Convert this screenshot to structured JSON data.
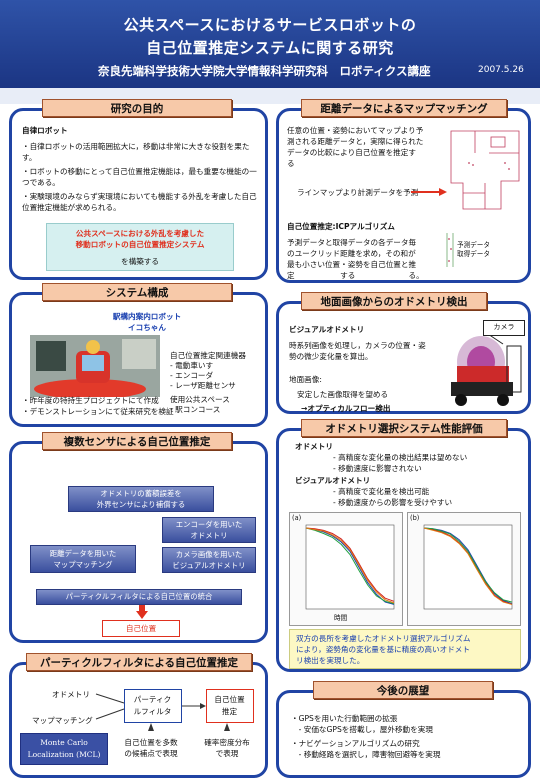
{
  "header": {
    "title_line1": "公共スペースにおけるサービスロボットの",
    "title_line2": "自己位置推定システムに関する研究",
    "affiliation": "奈良先端科学技術大学院大学情報科学研究科　ロボティクス講座",
    "date": "2007.5.26"
  },
  "purpose": {
    "title": "研究の目的",
    "heading": "自律ロボット",
    "bullets": [
      "・自律ロボットの活用範囲拡大に，移動は非常に大きな役割を果たす。",
      "・ロボットの移動にとって自己位置推定機能は，最も重要な機能の一つである。",
      "・実験環境のみならず実環境においても機能する外乱を考慮した自己位置推定機能が求められる。"
    ],
    "highlight_line1": "公共スペースにおける外乱を考慮した",
    "highlight_line2": "移動ロボットの自己位置推定システム",
    "highlight_line3": "を構築する"
  },
  "system": {
    "title": "システム構成",
    "robot_line1": "駅構内案内ロボット",
    "robot_line2": "イコちゃん",
    "devices_title": "自己位置推定関連機器",
    "devices": [
      "- 電動車いす",
      "- エンコーダ",
      "- レーザ距離センサ"
    ],
    "space_title": "使用公共スペース",
    "space_item": "- 駅コンコース",
    "notes": [
      "・昨年度の特持生プロジェクトにて作成",
      "・デモンストレーションにて従来研究を検証"
    ]
  },
  "multi_sensor": {
    "title": "複数センサによる自己位置推定",
    "top_box_line1": "オドメトリの蓄積誤差を",
    "top_box_line2": "外界センサにより補償する",
    "box_encoder_line1": "エンコーダを用いた",
    "box_encoder_line2": "オドメトリ",
    "box_map_line1": "距離データを用いた",
    "box_map_line2": "マップマッチング",
    "box_visual_line1": "カメラ画像を用いた",
    "box_visual_line2": "ビジュアルオドメトリ",
    "integration": "パーティクルフィルタによる自己位置の統合",
    "result": "自己位置"
  },
  "particle": {
    "title": "パーティクルフィルタによる自己位置推定",
    "input_odometry": "オドメトリ",
    "input_map": "マップマッチング",
    "filter_line1": "パーティク",
    "filter_line2": "ルフィルタ",
    "output_line1": "自己位置",
    "output_line2": "推定",
    "mcl_line1": "Monte Carlo",
    "mcl_line2": "Localization (MCL)",
    "note_left_line1": "自己位置を多数",
    "note_left_line2": "の候補点で表現",
    "note_right_line1": "確率密度分布",
    "note_right_line2": "で表現"
  },
  "map_matching": {
    "title": "距離データによるマップマッチング",
    "text_lines": [
      "任意の位置・姿勢においてマップより予",
      "測される距離データと，実際に得られた",
      "データの比較により自己位置を推定す",
      "る"
    ],
    "arrow_label": "ラインマップより計測データを予測",
    "icp_title": "自己位置推定:ICPアルゴリズム",
    "icp_lines": [
      "予測データと取得データの各データ毎",
      "のユークリッド距離を求め，その和が",
      "最も小さい位置・姿勢を自己位置と推",
      "定　　　　　　する　　　　　　　る。"
    ],
    "legend_pred": "予測データ",
    "legend_meas": "取得データ"
  },
  "visual_odometry": {
    "title": "地面画像からのオドメトリ検出",
    "heading": "ビジュアルオドメトリ",
    "text_lines": [
      "時系列画像を処理し，カメラの位置・姿",
      "勢の微少変化量を算出。"
    ],
    "ground_title": "地面画像:",
    "ground_text": "安定した画像取得を望める",
    "optical_flow": "→オプティカルフロー検出",
    "camera_label": "カメラ"
  },
  "evaluation": {
    "title": "オドメトリ選択システム性能評価",
    "odometry_title": "オドメトリ",
    "odometry_points": [
      "- 高精度な変化量の検出結果は望めない",
      "- 移動速度に影響されない"
    ],
    "visual_title": "ビジュアルオドメトリ",
    "visual_points": [
      "- 高精度で変化量を検出可能",
      "- 移動速度からの影響を受けやすい"
    ],
    "chart_left_label": "(a)",
    "chart_right_label": "(b)",
    "conclusion_lines": [
      "双方の長所を考慮したオドメトリ選択アルゴリズム",
      "により，姿勢角の変化量を基に精度の高いオドメト",
      "リ検出を実現した。"
    ]
  },
  "chart_data": [
    {
      "type": "line",
      "title": "",
      "xlabel": "時間",
      "ylabel": "",
      "x": [
        0,
        1,
        2,
        3,
        4,
        5,
        6,
        7,
        8,
        9,
        10
      ],
      "series": [
        {
          "values": [
            1.0,
            0.98,
            0.95,
            0.9,
            0.82,
            0.7,
            0.5,
            0.3,
            0.15,
            0.05,
            0.02
          ]
        },
        {
          "values": [
            1.0,
            0.99,
            0.97,
            0.93,
            0.86,
            0.74,
            0.55,
            0.35,
            0.2,
            0.1,
            0.06
          ]
        },
        {
          "values": [
            1.0,
            0.97,
            0.93,
            0.88,
            0.79,
            0.66,
            0.46,
            0.27,
            0.13,
            0.06,
            0.03
          ]
        },
        {
          "values": [
            1.0,
            0.98,
            0.96,
            0.91,
            0.84,
            0.72,
            0.53,
            0.33,
            0.18,
            0.08,
            0.04
          ]
        }
      ]
    },
    {
      "type": "line",
      "title": "",
      "xlabel": "",
      "ylabel": "",
      "x": [
        0,
        1,
        2,
        3,
        4,
        5,
        6,
        7,
        8,
        9,
        10
      ],
      "series": [
        {
          "values": [
            1.0,
            0.99,
            0.97,
            0.93,
            0.85,
            0.72,
            0.52,
            0.32,
            0.16,
            0.07,
            0.03
          ]
        },
        {
          "values": [
            1.0,
            0.98,
            0.95,
            0.9,
            0.81,
            0.68,
            0.49,
            0.3,
            0.14,
            0.06,
            0.02
          ]
        },
        {
          "values": [
            1.0,
            0.99,
            0.96,
            0.92,
            0.83,
            0.7,
            0.5,
            0.31,
            0.17,
            0.08,
            0.05
          ]
        },
        {
          "values": [
            1.0,
            0.97,
            0.94,
            0.89,
            0.8,
            0.67,
            0.47,
            0.28,
            0.13,
            0.05,
            0.02
          ]
        }
      ]
    }
  ],
  "future": {
    "title": "今後の展望",
    "lines": [
      "・GPSを用いた行動範囲の拡張",
      "　- 安価なGPSを搭載し，屋外移動を実現",
      "・ナビゲーションアルゴリズムの研究",
      "　- 移動経路を選択し，障害物回避等を実現"
    ]
  },
  "colors": {
    "header_blue": "#1b3583",
    "panel_border": "#2044a4",
    "title_fill": "#f7c9a9",
    "accent_red": "#e0301e"
  }
}
